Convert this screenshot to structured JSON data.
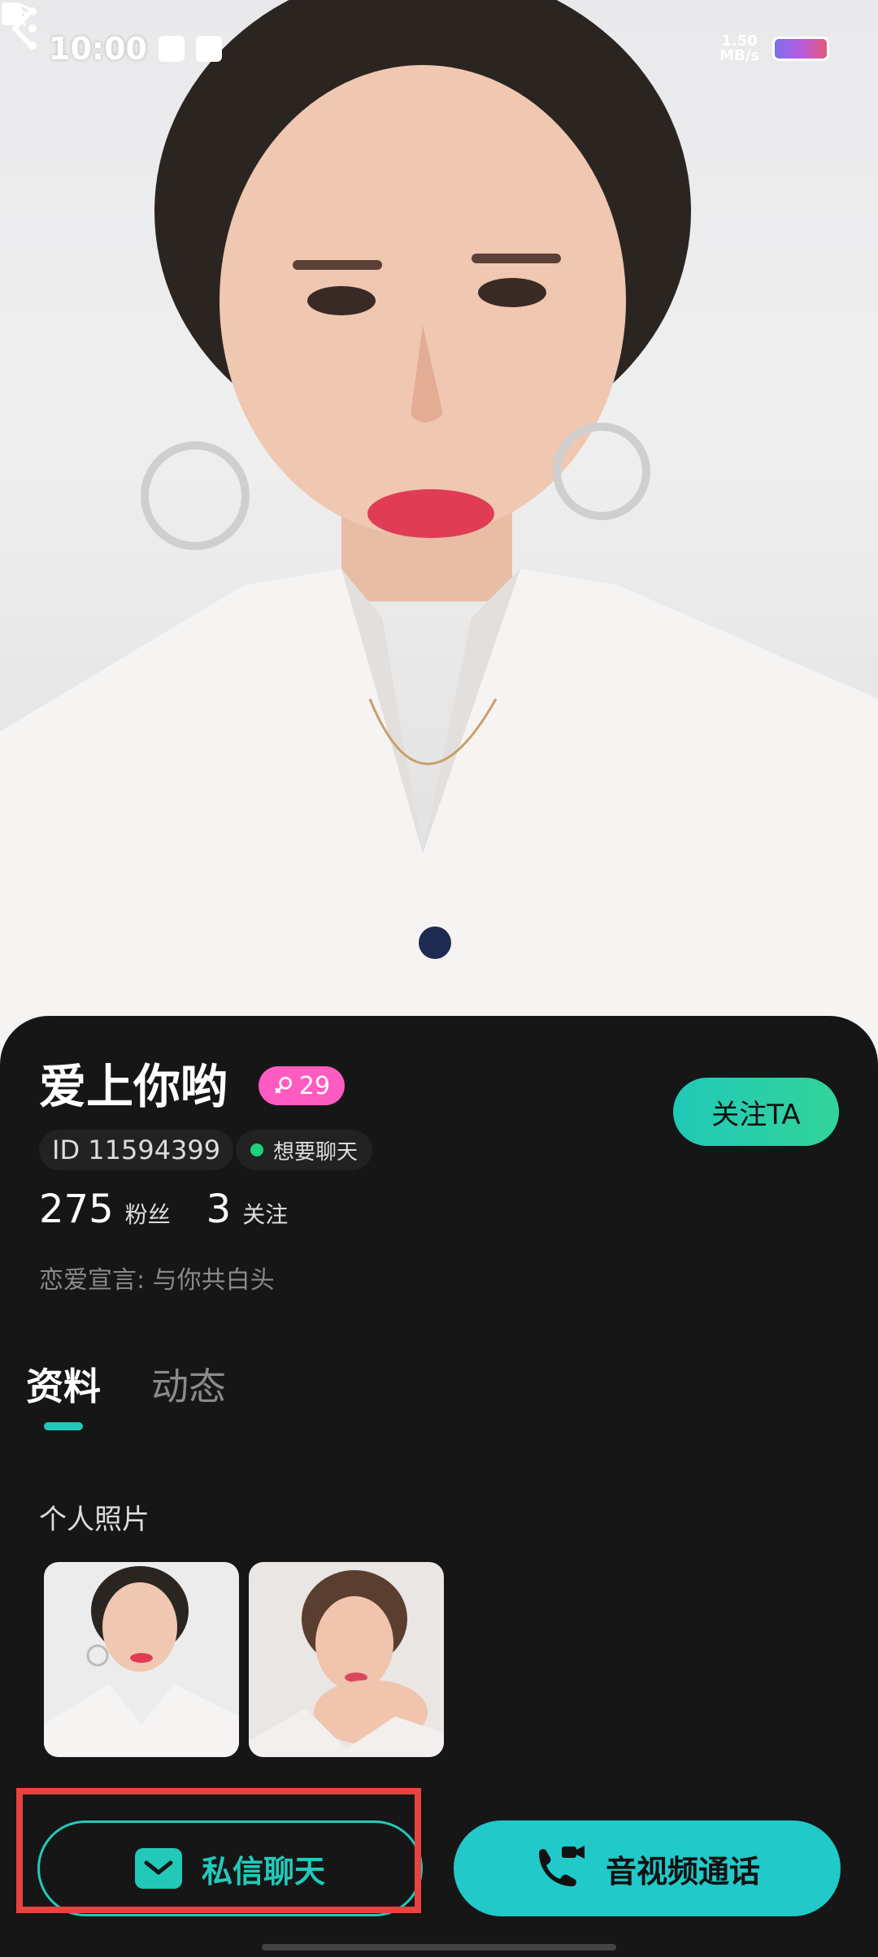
{
  "status_bar": {
    "time": "10:00",
    "net_speed": "1.50",
    "net_unit": "MB/s"
  },
  "icons": {
    "back": "back-icon",
    "more": "more-vertical-icon",
    "gender": "female-icon",
    "message": "mail-icon",
    "call": "video-call-icon"
  },
  "profile": {
    "name": "爱上你哟",
    "age": "29",
    "id_text": "ID 11594399",
    "status_text": "想要聊天",
    "follow_label": "关注TA",
    "fans_count": "275",
    "fans_label": "粉丝",
    "following_count": "3",
    "following_label": "关注",
    "motto": "恋爱宣言: 与你共白头"
  },
  "tabs": [
    {
      "label": "资料",
      "active": true
    },
    {
      "label": "动态",
      "active": false
    }
  ],
  "photos_section": {
    "title": "个人照片"
  },
  "actions": {
    "message_label": "私信聊天",
    "call_label": "音视频通话"
  },
  "colors": {
    "accent": "#22c9b9",
    "badge": "#ff5bc0",
    "background": "#161616",
    "highlight": "#e8433f"
  }
}
